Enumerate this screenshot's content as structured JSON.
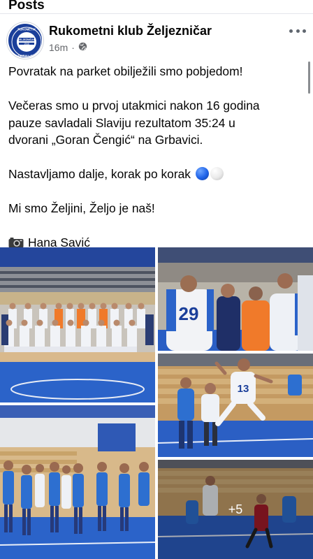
{
  "section": {
    "title": "Posts"
  },
  "post": {
    "author": "Rukometni klub Željezničar",
    "time": "16m",
    "audience_icon": "globe-icon",
    "more_icon": "more-options-icon",
    "logo": {
      "top_text": "RUKOMETNI",
      "mid_text": "ŽELJEZNIČAR",
      "bottom_text": "HANDBALL CLUB",
      "year": "1946"
    },
    "text": {
      "line1": "Povratak na parket obilježili smo pobjedom!",
      "line2a": "Večeras smo u prvoj utakmici nakon 16 godina",
      "line2b": "pauze savladali Slaviju rezultatom 35:24 u",
      "line2c": "dvorani „Goran Čengić“ na Grbavici.",
      "line3": "Nastavljamo dalje, korak po korak",
      "line4": "Mi smo Željini, Željo je naš!",
      "credit": "Hana Savić"
    },
    "photos": {
      "jersey_number_1": "29",
      "jersey_number_2": "13",
      "more_count": "+5"
    },
    "colors": {
      "club_blue": "#1b3f9a",
      "court_blue": "#2b63c9",
      "floor_wood": "#d9b98c",
      "orange_kit": "#f07a2a"
    }
  }
}
